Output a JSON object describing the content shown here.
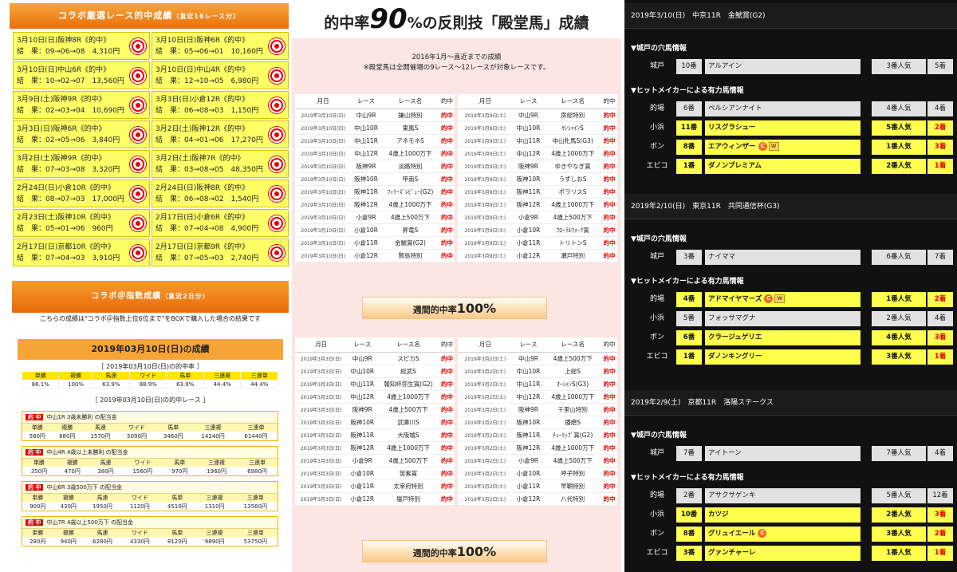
{
  "panelA": {
    "title": "コラボ厳選レース的中成績",
    "title_note": "（直近16レース分）",
    "hits": [
      {
        "race": "3月10日(日)阪神8R《的中》",
        "result": "結　果：09→06→08　4,310円"
      },
      {
        "race": "3月10日(日)阪神6R《的中》",
        "result": "結　果：05→06→01　10,160円"
      },
      {
        "race": "3月10日(日)中山6R《的中》",
        "result": "結　果：10→02→07　13,560円"
      },
      {
        "race": "3月10日(日)中山4R《的中》",
        "result": "結　果：12→10→05　6,980円"
      },
      {
        "race": "3月9日(土)阪神9R《的中》",
        "result": "結　果：02→03→04　10,690円"
      },
      {
        "race": "3月3日(日)小倉12R《的中》",
        "result": "結　果：06→08→03　1,150円"
      },
      {
        "race": "3月3日(日)阪神6R《的中》",
        "result": "結　果：02→05→06　3,840円"
      },
      {
        "race": "3月2日(土)阪神12R《的中》",
        "result": "結　果：04→01→06　17,270円"
      },
      {
        "race": "3月2日(土)阪神9R《的中》",
        "result": "結　果：07→03→08　3,320円"
      },
      {
        "race": "3月2日(土)阪神7R《的中》",
        "result": "結　果：03→08→05　48,350円"
      },
      {
        "race": "2月24日(日)小倉10R《的中》",
        "result": "結　果：08→07→03　17,000円"
      },
      {
        "race": "2月24日(日)阪神8R《的中》",
        "result": "結　果：06→08→02　1,540円"
      },
      {
        "race": "2月23日(土)阪神10R《的中》",
        "result": "結　果：05→01→06　960円"
      },
      {
        "race": "2月17日(日)小倉6R《的中》",
        "result": "結　果：07→04→08　4,900円"
      },
      {
        "race": "2月17日(日)京都10R《的中》",
        "result": "結　果：07→04→03　3,910円"
      },
      {
        "race": "2月17日(日)京都9R《的中》",
        "result": "結　果：07→05→03　2,740円"
      }
    ]
  },
  "panelB": {
    "title": "コラボ＠指数成績",
    "title_note": "（直近2日分）",
    "note": "こちらの成績は\"コラボ＠指数上位6位まで\"をBOXで購入した場合の結果です",
    "date_title": "2019年03月10日(日)の成績",
    "rate_title": "［ 2019年03月10日(日)の的中率 ］",
    "bet_types": [
      "単勝",
      "複勝",
      "馬連",
      "ワイド",
      "馬単",
      "三連複",
      "三連単"
    ],
    "rates": [
      "86.1%",
      "100%",
      "63.9%",
      "88.9%",
      "63.9%",
      "44.4%",
      "44.4%"
    ],
    "hits_title": "［ 2019年03月10日(日)の的中レース ］",
    "hit_badge": "的 中",
    "races": [
      {
        "name": "中山1R 3歳未勝利 の配当金",
        "pay": [
          "580円",
          "880円",
          "1570円",
          "5090円",
          "3460円",
          "14240円",
          "61440円"
        ]
      },
      {
        "name": "中山4R 4歳以上未勝利 の配当金",
        "pay": [
          "350円",
          "470円",
          "380円",
          "1560円",
          "970円",
          "1960円",
          "6980円"
        ]
      },
      {
        "name": "中山6R 3歳500万下 の配当金",
        "pay": [
          "900円",
          "430円",
          "1950円",
          "1120円",
          "4510円",
          "1310円",
          "13560円"
        ]
      },
      {
        "name": "中山7R 4歳以上500万下 の配当金",
        "pay": [
          "280円",
          "940円",
          "6280円",
          "4330円",
          "8120円",
          "9890円",
          "53750円"
        ]
      }
    ]
  },
  "panelC": {
    "title_pre": "的中率",
    "title_big": "90",
    "title_post": "%の反則技「殿堂馬」成績",
    "sub1": "2016年1月～直近までの成績",
    "sub2": "※殿堂馬は全開催場の9レース～12レースが対象レースです。",
    "headers": [
      "月日",
      "レース",
      "レース名",
      "的中"
    ],
    "tables": [
      [
        [
          "2019年3月10日(日)",
          "中山9R",
          "鎌山特別",
          "的中"
        ],
        [
          "2019年3月10日(日)",
          "中山10R",
          "東風S",
          "的中"
        ],
        [
          "2019年3月10日(日)",
          "中山11R",
          "アネモネS",
          "的中"
        ],
        [
          "2019年3月10日(日)",
          "中山12R",
          "4歳上1000万下",
          "的中"
        ],
        [
          "2019年3月10日(日)",
          "阪神9R",
          "淡路特別",
          "的中"
        ],
        [
          "2019年3月10日(日)",
          "阪神10R",
          "甲南S",
          "的中"
        ],
        [
          "2019年3月10日(日)",
          "阪神11R",
          "ﾌｨﾘｰｽﾞﾚﾋﾞｭｰ(G2)",
          "的中"
        ],
        [
          "2019年3月10日(日)",
          "阪神12R",
          "4歳上1000万下",
          "的中"
        ],
        [
          "2019年3月10日(日)",
          "小倉9R",
          "4歳上500万下",
          "的中"
        ],
        [
          "2019年3月10日(日)",
          "小倉10R",
          "昇竜S",
          "的中"
        ],
        [
          "2019年3月10日(日)",
          "小倉11R",
          "金鯱賞(G2)",
          "的中"
        ],
        [
          "2019年3月10日(日)",
          "小倉12R",
          "賢島特別",
          "的中"
        ]
      ],
      [
        [
          "2019年3月9日(土)",
          "中山9R",
          "房総特別",
          "的中"
        ],
        [
          "2019年3月9日(土)",
          "中山10R",
          "ｻﾝｼｬｲﾝS",
          "的中"
        ],
        [
          "2019年3月9日(土)",
          "中山11R",
          "中山牝馬S(G3)",
          "的中"
        ],
        [
          "2019年3月9日(土)",
          "中山12R",
          "4歳上1000万下",
          "的中"
        ],
        [
          "2019年3月9日(土)",
          "阪神9R",
          "ゆきやなぎ賞",
          "的中"
        ],
        [
          "2019年3月9日(土)",
          "阪神10R",
          "うずしおS",
          "的中"
        ],
        [
          "2019年3月9日(土)",
          "阪神11R",
          "ポラリスS",
          "的中"
        ],
        [
          "2019年3月9日(土)",
          "阪神12R",
          "4歳上1000万下",
          "的中"
        ],
        [
          "2019年3月9日(土)",
          "小倉9R",
          "4歳上500万下",
          "的中"
        ],
        [
          "2019年3月9日(土)",
          "小倉10R",
          "ﾌﾛｰﾗﾙｳｫｰｸ賞",
          "的中"
        ],
        [
          "2019年3月9日(土)",
          "小倉11R",
          "トリトンS",
          "的中"
        ],
        [
          "2019年3月9日(土)",
          "小倉12R",
          "瀬戸特別",
          "的中"
        ]
      ],
      [
        [
          "2019年3月3日(日)",
          "中山9R",
          "スピカS",
          "的中"
        ],
        [
          "2019年3月3日(日)",
          "中山10R",
          "総武S",
          "的中"
        ],
        [
          "2019年3月3日(日)",
          "中山11R",
          "報知杯弥生賞(G2)",
          "的中"
        ],
        [
          "2019年3月3日(日)",
          "中山12R",
          "4歳上1000万下",
          "的中"
        ],
        [
          "2019年3月3日(日)",
          "阪神9R",
          "4歳上500万下",
          "的中"
        ],
        [
          "2019年3月3日(日)",
          "阪神10R",
          "武庫川S",
          "的中"
        ],
        [
          "2019年3月3日(日)",
          "阪神11R",
          "大阪城S",
          "的中"
        ],
        [
          "2019年3月3日(日)",
          "阪神12R",
          "4歳上1000万下",
          "的中"
        ],
        [
          "2019年3月3日(日)",
          "小倉9R",
          "4歳上500万下",
          "的中"
        ],
        [
          "2019年3月3日(日)",
          "小倉10R",
          "筑紫賞",
          "的中"
        ],
        [
          "2019年3月3日(日)",
          "小倉11R",
          "太宰府特別",
          "的中"
        ],
        [
          "2019年3月3日(日)",
          "小倉12R",
          "壇戸特別",
          "的中"
        ]
      ],
      [
        [
          "2019年3月2日(土)",
          "中山9R",
          "4歳上500万下",
          "的中"
        ],
        [
          "2019年3月2日(土)",
          "中山10R",
          "上総S",
          "的中"
        ],
        [
          "2019年3月2日(土)",
          "中山11R",
          "ｵｰｼｬﾝS(G3)",
          "的中"
        ],
        [
          "2019年3月2日(土)",
          "中山12R",
          "4歳上1000万下",
          "的中"
        ],
        [
          "2019年3月2日(土)",
          "阪神9R",
          "千里山特別",
          "的中"
        ],
        [
          "2019年3月2日(土)",
          "阪神10R",
          "播磨S",
          "的中"
        ],
        [
          "2019年3月2日(土)",
          "阪神11R",
          "ﾁｭｰﾘｯﾌﾟ賞(G2)",
          "的中"
        ],
        [
          "2019年3月2日(土)",
          "阪神12R",
          "4歳上1000万下",
          "的中"
        ],
        [
          "2019年3月2日(土)",
          "小倉9R",
          "4歳上500万下",
          "的中"
        ],
        [
          "2019年3月2日(土)",
          "小倉10R",
          "呼子特別",
          "的中"
        ],
        [
          "2019年3月2日(土)",
          "小倉11R",
          "早鞆特別",
          "的中"
        ],
        [
          "2019年3月2日(土)",
          "小倉12R",
          "八代特別",
          "的中"
        ]
      ]
    ],
    "weekly_label": "週間的中率",
    "weekly_value": "100%"
  },
  "panelD": {
    "section1": "▼城戸の穴馬情報",
    "section2": "▼ヒットメイカーによる有力馬情報",
    "badge_c": "C",
    "badge_w": "W",
    "races": [
      {
        "header": "2019年3/10(日)　中京11R　金鯱賞(G2)",
        "kido": {
          "name": "城戸",
          "num": "10番",
          "horse": "アルアイン",
          "pop": "3番人気",
          "result": "5着"
        },
        "makers": [
          {
            "name": "的場",
            "num": "6番",
            "horse": "ペルシアンナイト",
            "pop": "4番人気",
            "result": "4着",
            "hit": false,
            "c": false,
            "w": false
          },
          {
            "name": "小浜",
            "num": "11番",
            "horse": "リスグラシュー",
            "pop": "5番人気",
            "result": "2着",
            "hit": true,
            "c": false,
            "w": false
          },
          {
            "name": "ボン",
            "num": "8番",
            "horse": "エアウィンザー",
            "pop": "1番人気",
            "result": "3着",
            "hit": true,
            "c": true,
            "w": true
          },
          {
            "name": "エビコ",
            "num": "1番",
            "horse": "ダノンプレミアム",
            "pop": "2番人気",
            "result": "1着",
            "hit": true,
            "c": false,
            "w": false
          }
        ]
      },
      {
        "header": "2019年2/10(日)　東京11R　共同通信杯(G3)",
        "kido": {
          "name": "城戸",
          "num": "3番",
          "horse": "ナイママ",
          "pop": "6番人気",
          "result": "7着"
        },
        "makers": [
          {
            "name": "的場",
            "num": "4番",
            "horse": "アドマイヤマーズ",
            "pop": "1番人気",
            "result": "2着",
            "hit": true,
            "c": true,
            "w": true
          },
          {
            "name": "小浜",
            "num": "5番",
            "horse": "フォッサマグナ",
            "pop": "2番人気",
            "result": "4着",
            "hit": false,
            "c": false,
            "w": false
          },
          {
            "name": "ボン",
            "num": "6番",
            "horse": "クラージュゲリエ",
            "pop": "4番人気",
            "result": "3着",
            "hit": true,
            "c": false,
            "w": false
          },
          {
            "name": "エビコ",
            "num": "1番",
            "horse": "ダノンキングリー",
            "pop": "3番人気",
            "result": "1着",
            "hit": true,
            "c": false,
            "w": false
          }
        ]
      },
      {
        "header": "2019年2/9(土)　京都11R　洛陽ステークス",
        "kido": {
          "name": "城戸",
          "num": "7番",
          "horse": "アイトーン",
          "pop": "7番人気",
          "result": "4着"
        },
        "makers": [
          {
            "name": "的場",
            "num": "2番",
            "horse": "アサクサゲンキ",
            "pop": "5番人気",
            "result": "12着",
            "hit": false,
            "c": false,
            "w": false
          },
          {
            "name": "小浜",
            "num": "10番",
            "horse": "カツジ",
            "pop": "2番人気",
            "result": "3着",
            "hit": true,
            "c": false,
            "w": false
          },
          {
            "name": "ボン",
            "num": "8番",
            "horse": "グリュイエール",
            "pop": "3番人気",
            "result": "2着",
            "hit": true,
            "c": true,
            "w": false
          },
          {
            "name": "エビコ",
            "num": "3番",
            "horse": "グァンチャーレ",
            "pop": "1番人気",
            "result": "1着",
            "hit": true,
            "c": false,
            "w": false
          }
        ]
      }
    ]
  }
}
